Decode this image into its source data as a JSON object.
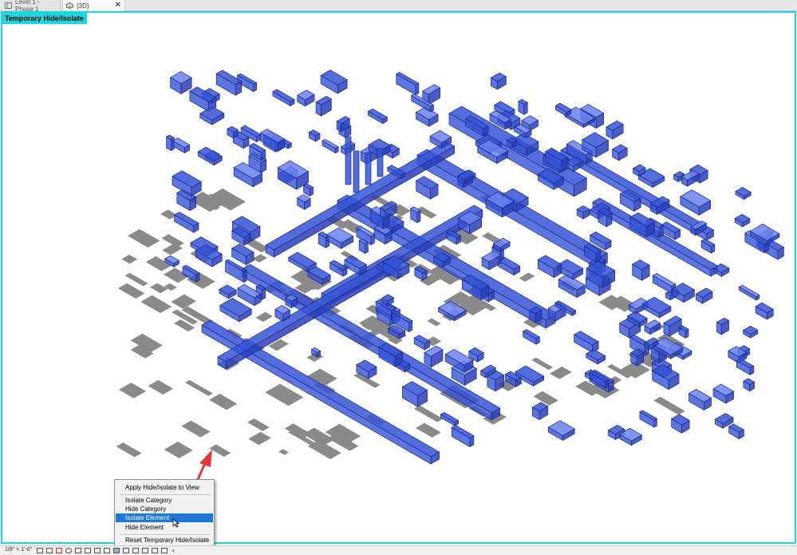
{
  "tabs": [
    {
      "label": "Level 1 - Phase 1",
      "icon": "floor-plan-icon"
    },
    {
      "label": "{3D}",
      "icon": "3d-view-icon"
    }
  ],
  "viewport": {
    "mode_label": "Temporary Hide/Isolate",
    "border_color": "#19d6e0"
  },
  "context_menu": {
    "items": [
      {
        "label": "Apply Hide/Isolate to View"
      },
      {
        "label": "Isolate Category"
      },
      {
        "label": "Hide Category"
      },
      {
        "label": "Isolate Element",
        "selected": true
      },
      {
        "label": "Hide Element"
      },
      {
        "label": "Reset Temporary Hide/Isolate"
      }
    ]
  },
  "status_bar": {
    "scale": "1/8\" = 1'-0\""
  },
  "colors": {
    "duct_fill": "#3553d6",
    "duct_edge": "#1b2a8c",
    "shadow": "#8a8a8a",
    "selection": "#1e78d7",
    "annotation_arrow": "#e03a3a"
  }
}
